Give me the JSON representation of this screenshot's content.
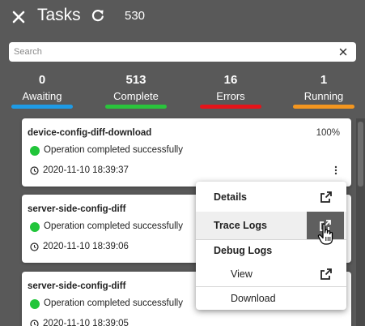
{
  "header": {
    "title": "Tasks",
    "count": "530"
  },
  "search": {
    "placeholder": "Search",
    "value": ""
  },
  "stats": [
    {
      "value": "0",
      "label": "Awaiting",
      "color": "#1e9be6"
    },
    {
      "value": "513",
      "label": "Complete",
      "color": "#2ac43c"
    },
    {
      "value": "16",
      "label": "Errors",
      "color": "#e5141a"
    },
    {
      "value": "1",
      "label": "Running",
      "color": "#f4961f"
    }
  ],
  "tasks": [
    {
      "name": "device-config-diff-download",
      "percent": "100%",
      "status": "Operation completed successfully",
      "time": "2020-11-10 18:39:37"
    },
    {
      "name": "server-side-config-diff",
      "percent": "",
      "status": "Operation completed successfully",
      "time": "2020-11-10 18:39:06"
    },
    {
      "name": "server-side-config-diff",
      "percent": "",
      "status": "Operation completed successfully",
      "time": "2020-11-10 18:39:05"
    }
  ],
  "menu": {
    "details": "Details",
    "trace_logs": "Trace Logs",
    "debug_logs": "Debug Logs",
    "view": "View",
    "download": "Download"
  },
  "colors": {
    "background": "#595959",
    "success": "#21c53a",
    "highlight": "#5f5f5f"
  }
}
